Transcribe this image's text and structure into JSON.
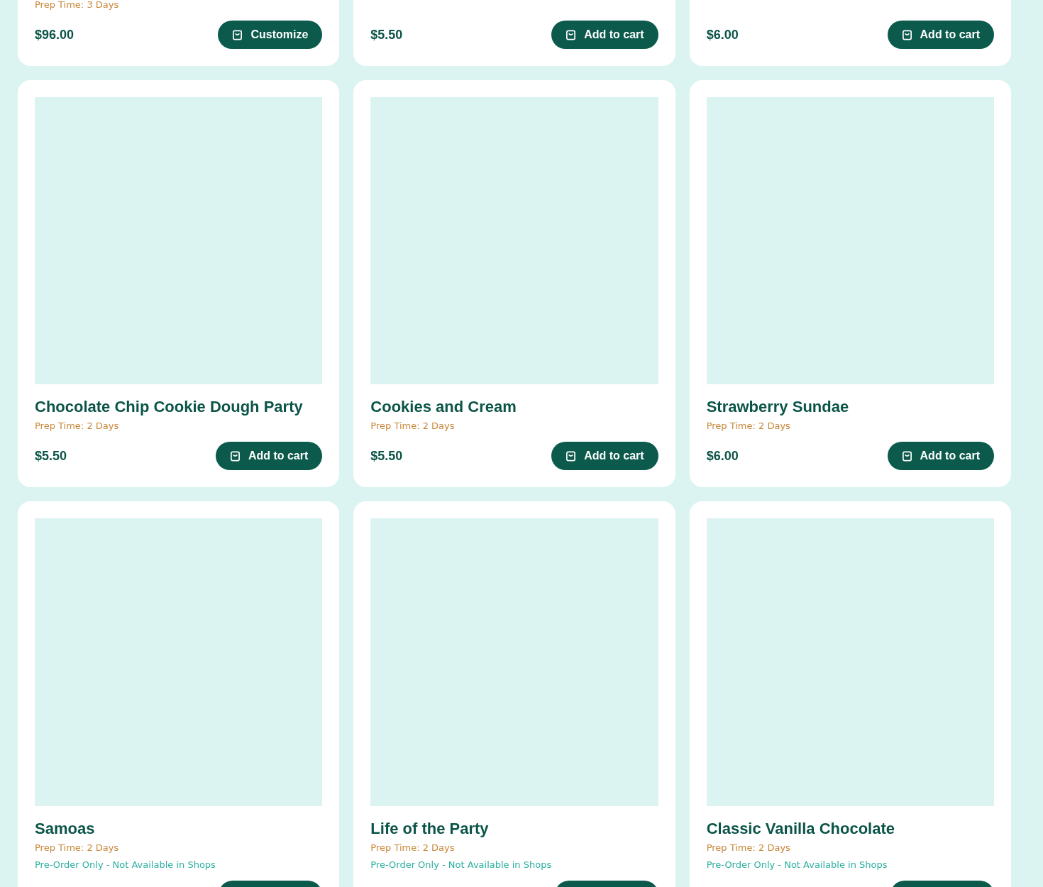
{
  "product_rows": [
    {
      "cards": [
        {
          "kind": "footer",
          "prep_time": "Prep Time: 3 Days",
          "price": "$96.00",
          "button": {
            "kind": "cart",
            "label": "Customize"
          }
        },
        {
          "kind": "footer",
          "price": "$5.50",
          "button": {
            "kind": "cart",
            "label": "Add to cart"
          }
        },
        {
          "kind": "footer",
          "price": "$6.00",
          "button": {
            "kind": "cart",
            "label": "Add to cart"
          }
        }
      ]
    },
    {
      "cards": [
        {
          "kind": "full",
          "title": "Chocolate Chip Cookie Dough Party",
          "prep_time": "Prep Time: 2 Days",
          "price": "$5.50",
          "button": {
            "kind": "cart",
            "label": "Add to cart"
          }
        },
        {
          "kind": "full",
          "title": "Cookies and Cream",
          "prep_time": "Prep Time: 2 Days",
          "price": "$5.50",
          "button": {
            "kind": "cart",
            "label": "Add to cart"
          }
        },
        {
          "kind": "full",
          "title": "Strawberry Sundae",
          "prep_time": "Prep Time: 2 Days",
          "price": "$6.00",
          "button": {
            "kind": "cart",
            "label": "Add to cart"
          }
        }
      ]
    },
    {
      "cards": [
        {
          "kind": "full",
          "title": "Samoas",
          "prep_time": "Prep Time: 2 Days",
          "notice": "Pre-Order Only - Not Available in Shops",
          "button": {
            "kind": "cart"
          }
        },
        {
          "kind": "full",
          "title": "Life of the Party",
          "prep_time": "Prep Time: 2 Days",
          "notice": "Pre-Order Only - Not Available in Shops",
          "button": {
            "kind": "cart"
          }
        },
        {
          "kind": "full",
          "title": "Classic Vanilla Chocolate",
          "prep_time": "Prep Time: 2 Days",
          "notice": "Pre-Order Only - Not Available in Shops",
          "button": {
            "kind": "cart"
          }
        }
      ]
    }
  ]
}
